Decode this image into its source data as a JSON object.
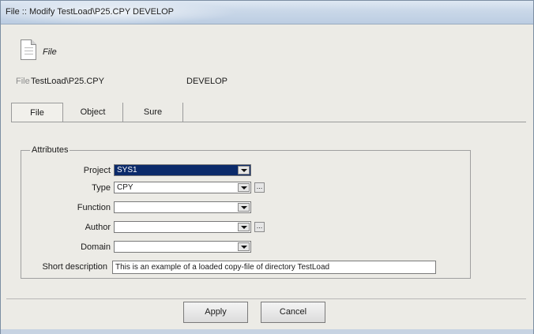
{
  "window": {
    "title": "File :: Modify TestLoad\\P25.CPY DEVELOP"
  },
  "header": {
    "icon": "document-icon",
    "icon_caption": "File",
    "file_label": "File",
    "file_value": "TestLoad\\P25.CPY",
    "environment": "DEVELOP"
  },
  "tabs": [
    {
      "label": "File",
      "active": true
    },
    {
      "label": "Object",
      "active": false
    },
    {
      "label": "Sure",
      "active": false
    }
  ],
  "attributes": {
    "legend": "Attributes",
    "project": {
      "label": "Project",
      "value": "SYS1"
    },
    "type": {
      "label": "Type",
      "value": "CPY"
    },
    "function": {
      "label": "Function",
      "value": ""
    },
    "author": {
      "label": "Author",
      "value": ""
    },
    "domain": {
      "label": "Domain",
      "value": ""
    },
    "short_description": {
      "label": "Short description",
      "value": "This is an example of a loaded copy-file of directory TestLoad"
    }
  },
  "buttons": {
    "apply": "Apply",
    "cancel": "Cancel",
    "ellipsis": "..."
  },
  "colors": {
    "selection": "#0b2a6a",
    "titlebar": "#c9d7e8"
  }
}
